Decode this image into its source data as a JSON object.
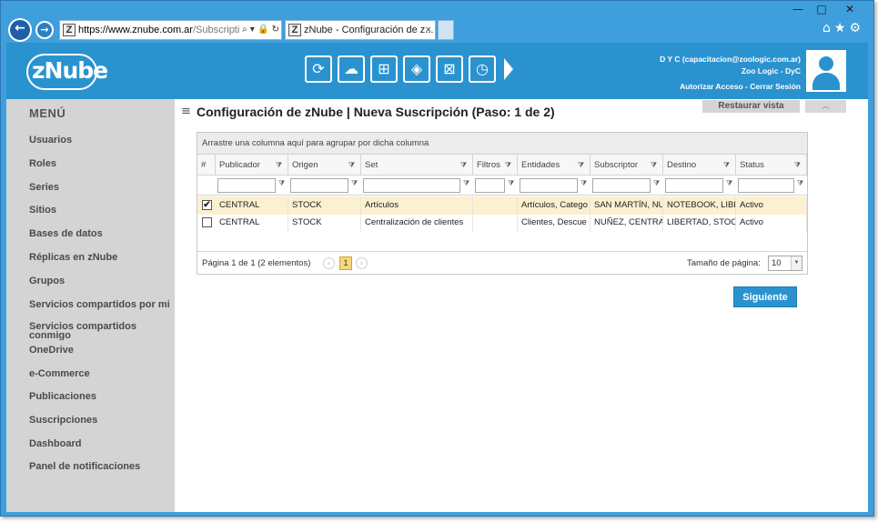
{
  "browser": {
    "address_host": "https://www.znube.com.ar",
    "address_path": "/Subscriptio",
    "tab_title": "zNube - Configuración de z...",
    "favicon_letter": "Z",
    "back_glyph": "←",
    "forward_glyph": "→",
    "address_tools": "⌕ ▾ 🔒 ↻",
    "tab_close": "×",
    "nav_icons": "⌂★⚙",
    "window_controls": {
      "minimize": "—",
      "maximize": "□",
      "close": "✕"
    }
  },
  "header": {
    "logo_text": "zNube",
    "modules": [
      {
        "icon": "users-refresh-icon",
        "glyph": "⟳"
      },
      {
        "icon": "cloud-settings-icon",
        "glyph": "☁"
      },
      {
        "icon": "network-icon",
        "glyph": "⊞"
      },
      {
        "icon": "box-icon",
        "glyph": "◈"
      },
      {
        "icon": "cart-icon",
        "glyph": "⊠"
      },
      {
        "icon": "clock-icon",
        "glyph": "◷"
      }
    ],
    "user_line1": "D Y C (capacitacion@zoologic.com.ar)",
    "user_line2": "Zoo Logic - DyC",
    "authorize_link": "Autorizar Acceso",
    "separator": "-",
    "logout_link": "Cerrar Sesión"
  },
  "sidebar": {
    "title": "MENÚ",
    "items": [
      "Usuarios",
      "Roles",
      "Series",
      "Sitios",
      "Bases de datos",
      "Réplicas en zNube",
      "Grupos",
      "Servicios compartidos por mi",
      "Servicios compartidos conmigo",
      "OneDrive",
      "e-Commerce",
      "Publicaciones",
      "Suscripciones",
      "Dashboard",
      "Panel de notificaciones"
    ]
  },
  "main": {
    "hamburger": "≡",
    "title": "Configuración de zNube | Nueva Suscripción (Paso: 1 de 2)",
    "restore_view": "Restaurar vista",
    "collapse_glyph": "︿",
    "next_button": "Siguiente"
  },
  "grid": {
    "group_hint": "Arrastre una columna aquí para agrupar por dicha columna",
    "columns": [
      "#",
      "Publicador",
      "Origen",
      "Set",
      "Filtros",
      "Entidades",
      "Subscriptor",
      "Destino",
      "Status"
    ],
    "filter_glyph": "⧩",
    "rows": [
      {
        "checked": true,
        "publicador": "CENTRAL",
        "origen": "STOCK",
        "set": "Artículos",
        "filtros": "",
        "entidades": "Artículos, Catego",
        "subscriptor": "SAN MARTÍN, NU",
        "destino": "NOTEBOOK, LIBE",
        "status": "Activo"
      },
      {
        "checked": false,
        "publicador": "CENTRAL",
        "origen": "STOCK",
        "set": "Centralización de clientes",
        "filtros": "",
        "entidades": "Clientes, Descue",
        "subscriptor": "NUÑEZ, CENTRA",
        "destino": "LIBERTAD, STOC",
        "status": "Activo"
      }
    ],
    "check_glyph": "✔",
    "pager_info": "Página 1 de 1 (2 elementos)",
    "pager_prev": "‹",
    "pager_current": "1",
    "pager_next": "›",
    "page_size_label": "Tamaño de página:",
    "page_size_value": "10",
    "page_size_dd": "▼"
  }
}
